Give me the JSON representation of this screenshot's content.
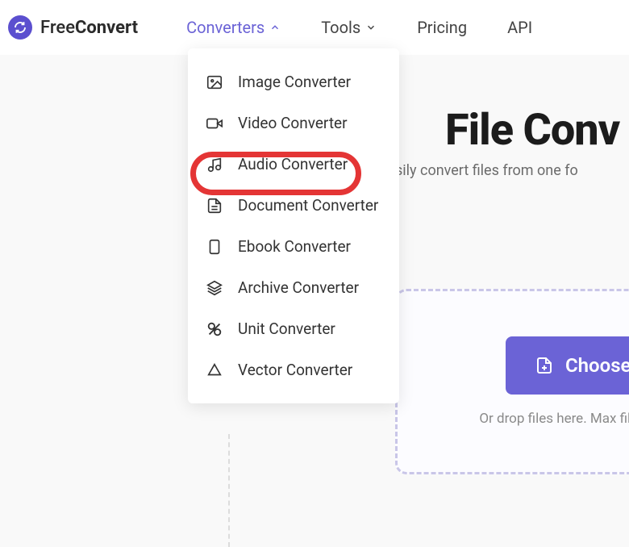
{
  "logo": {
    "free": "Free",
    "convert": "Convert"
  },
  "nav": {
    "converters": "Converters",
    "tools": "Tools",
    "pricing": "Pricing",
    "api": "API"
  },
  "dropdown": {
    "image": "Image Converter",
    "video": "Video Converter",
    "audio": "Audio Converter",
    "document": "Document Converter",
    "ebook": "Ebook Converter",
    "archive": "Archive Converter",
    "unit": "Unit Converter",
    "vector": "Vector Converter"
  },
  "hero": {
    "title": "File Conv",
    "subtitle": "sily convert files from one fo"
  },
  "dropzone": {
    "button": "Choose File",
    "hint": "Or drop files here. Max file size"
  }
}
